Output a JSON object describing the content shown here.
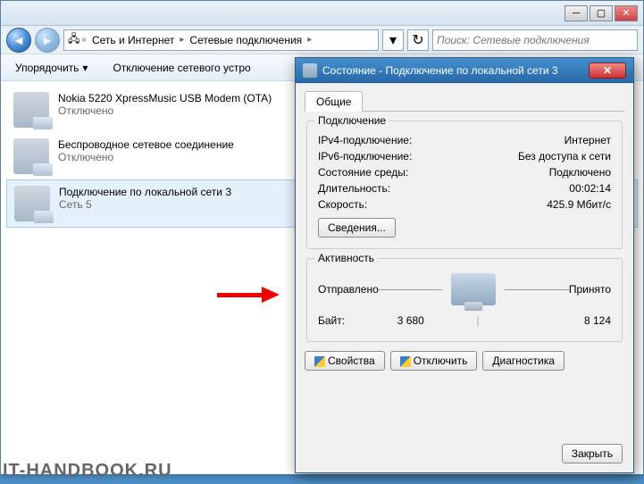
{
  "explorer": {
    "breadcrumb": {
      "seg1": "Сеть и Интернет",
      "seg2": "Сетевые подключения"
    },
    "search_placeholder": "Поиск: Сетевые подключения",
    "toolbar": {
      "organize": "Упорядочить",
      "disable": "Отключение сетевого устро"
    },
    "connections": [
      {
        "name": "Nokia 5220 XpressMusic USB Modem (OTA)",
        "status": "Отключено"
      },
      {
        "name": "Беспроводное сетевое соединение",
        "status": "Отключено"
      },
      {
        "name": "Подключение по локальной сети 3",
        "status": "Сеть 5"
      }
    ]
  },
  "dialog": {
    "title": "Состояние - Подключение по локальной сети 3",
    "tab_general": "Общие",
    "group_conn_title": "Подключение",
    "rows_conn": {
      "ipv4_l": "IPv4-подключение:",
      "ipv4_v": "Интернет",
      "ipv6_l": "IPv6-подключение:",
      "ipv6_v": "Без доступа к сети",
      "media_l": "Состояние среды:",
      "media_v": "Подключено",
      "dur_l": "Длительность:",
      "dur_v": "00:02:14",
      "spd_l": "Скорость:",
      "spd_v": "425.9 Мбит/с"
    },
    "btn_details": "Сведения...",
    "group_act_title": "Активность",
    "activity": {
      "sent_l": "Отправлено",
      "recv_l": "Принято",
      "bytes_l": "Байт:",
      "sent_v": "3 680",
      "recv_v": "8 124"
    },
    "buttons": {
      "props": "Свойства",
      "disable": "Отключить",
      "diag": "Диагностика",
      "close": "Закрыть"
    }
  },
  "watermark": "IT-HANDBOOK.RU"
}
